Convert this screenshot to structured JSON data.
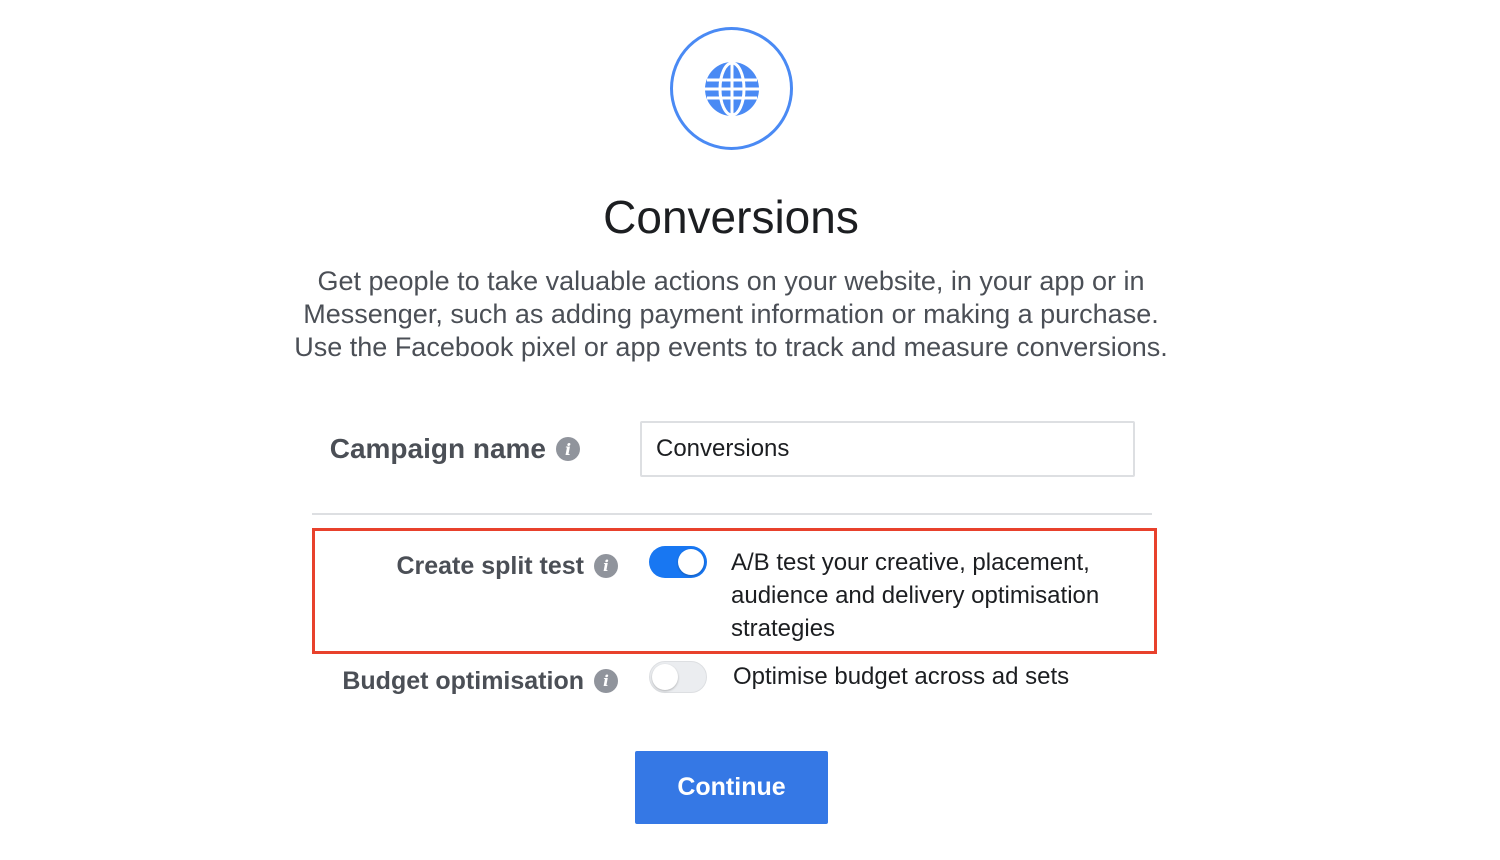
{
  "header": {
    "icon": "globe-icon",
    "title": "Conversions",
    "description_lines": [
      "Get people to take valuable actions on your website, in your app or in",
      "Messenger, such as adding payment information or making a purchase.",
      "Use the Facebook pixel or app events to track and measure conversions."
    ]
  },
  "campaign": {
    "label": "Campaign name",
    "info_icon": "i",
    "value": "Conversions"
  },
  "split_test": {
    "label": "Create split test",
    "info_icon": "i",
    "enabled": true,
    "description": "A/B test your creative, placement, audience and delivery optimisation strategies"
  },
  "budget": {
    "label": "Budget optimisation",
    "info_icon": "i",
    "enabled": false,
    "description": "Optimise budget across ad sets"
  },
  "actions": {
    "continue_label": "Continue"
  },
  "colors": {
    "accent": "#3578e5",
    "toggle_on": "#1877f2",
    "highlight": "#e8412c",
    "globe": "#4a8af4"
  }
}
